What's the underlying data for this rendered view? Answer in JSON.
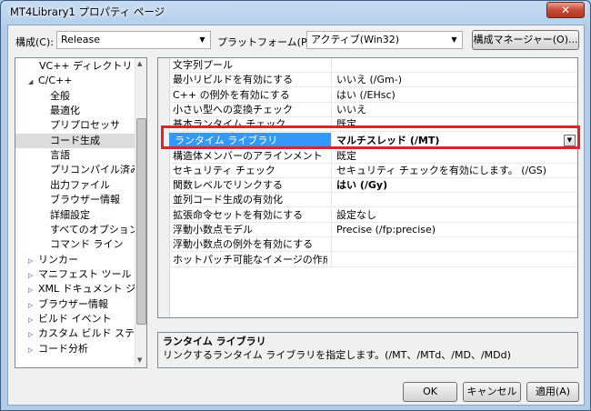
{
  "window": {
    "title": "MT4Library1 プロパティ ページ",
    "close_label": "✕"
  },
  "toolbar": {
    "config_label": "構成(C):",
    "config_value": "Release",
    "platform_label": "プラットフォーム(P):",
    "platform_value": "アクティブ(Win32)",
    "config_manager_label": "構成マネージャー(O)..."
  },
  "tree": {
    "items": [
      {
        "label": "VC++ ディレクトリ",
        "expander": ""
      },
      {
        "label": "C/C++",
        "expander": "◢"
      },
      {
        "label": "全般",
        "expander": ""
      },
      {
        "label": "最適化",
        "expander": ""
      },
      {
        "label": "プリプロセッサ",
        "expander": ""
      },
      {
        "label": "コード生成",
        "expander": ""
      },
      {
        "label": "言語",
        "expander": ""
      },
      {
        "label": "プリコンパイル済みヘ",
        "expander": ""
      },
      {
        "label": "出力ファイル",
        "expander": ""
      },
      {
        "label": "ブラウザー情報",
        "expander": ""
      },
      {
        "label": "詳細設定",
        "expander": ""
      },
      {
        "label": "すべてのオプション",
        "expander": ""
      },
      {
        "label": "コマンド ライン",
        "expander": ""
      },
      {
        "label": "リンカー",
        "expander": "▷"
      },
      {
        "label": "マニフェスト ツール",
        "expander": "▷"
      },
      {
        "label": "XML ドキュメント ジェ",
        "expander": "▷"
      },
      {
        "label": "ブラウザー情報",
        "expander": "▷"
      },
      {
        "label": "ビルド イベント",
        "expander": "▷"
      },
      {
        "label": "カスタム ビルド ステッ",
        "expander": "▷"
      },
      {
        "label": "コード分析",
        "expander": "▷"
      }
    ]
  },
  "grid": {
    "rows": [
      {
        "name": "文字列プール",
        "value": ""
      },
      {
        "name": "最小リビルドを有効にする",
        "value": "いいえ (/Gm-)"
      },
      {
        "name": "C++ の例外を有効にする",
        "value": "はい (/EHsc)"
      },
      {
        "name": "小さい型への変換チェック",
        "value": "いいえ"
      },
      {
        "name": "基本ランタイム チェック",
        "value": "既定"
      },
      {
        "name": "ランタイム ライブラリ",
        "value": "マルチスレッド (/MT)"
      },
      {
        "name": "構造体メンバーのアラインメント",
        "value": "既定"
      },
      {
        "name": "セキュリティ チェック",
        "value": "セキュリティ チェックを有効にします。 (/GS)"
      },
      {
        "name": "関数レベルでリンクする",
        "value": "はい (/Gy)"
      },
      {
        "name": "並列コード生成の有効化",
        "value": ""
      },
      {
        "name": "拡張命令セットを有効にする",
        "value": "設定なし"
      },
      {
        "name": "浮動小数点モデル",
        "value": "Precise (/fp:precise)"
      },
      {
        "name": "浮動小数点の例外を有効にする",
        "value": ""
      },
      {
        "name": "ホットパッチ可能なイメージの作成",
        "value": ""
      }
    ]
  },
  "description": {
    "title": "ランタイム ライブラリ",
    "text": "リンクするランタイム ライブラリを指定します。(/MT、/MTd、/MD、/MDd)"
  },
  "buttons": {
    "ok": "OK",
    "cancel": "キャンセル",
    "apply": "適用(A)"
  },
  "colors": {
    "selection": "#3399ff",
    "highlight_box": "#e0232b"
  }
}
